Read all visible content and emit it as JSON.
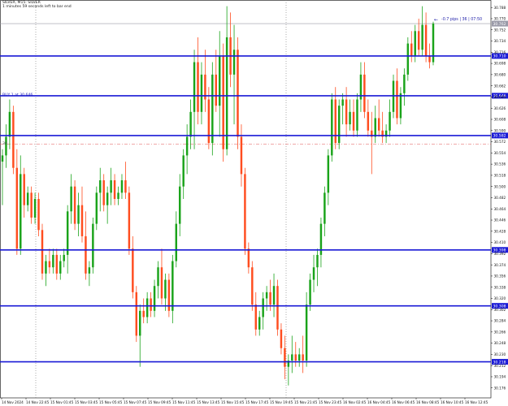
{
  "header": {
    "symbol_line": "SILVER, M15:  SILVER",
    "countdown": "1 minutes 59 seconds left to bar end"
  },
  "buy_label": "BUY 1 at 30.646",
  "side_number": "30.",
  "pip_info": "-0.7 pips | 36 | 07:50",
  "pip_arrow": "←",
  "colors": {
    "bull": "#1aa31a",
    "bear": "#ff4d1f",
    "hline": "#1a1ad6",
    "bid_line": "#e05050",
    "price_box": "#1a1ad6",
    "current_line": "#9a9aa8"
  },
  "chart_data": {
    "type": "candlestick",
    "timeframe": "M15",
    "ylim": [
      30.16,
      30.8
    ],
    "y_tick_labels": [
      "30.788",
      "30.770",
      "30.752",
      "30.734",
      "30.716",
      "30.698",
      "30.680",
      "30.662",
      "30.644",
      "30.626",
      "30.608",
      "30.590",
      "30.572",
      "30.554",
      "30.536",
      "30.518",
      "30.500",
      "30.482",
      "30.464",
      "30.446",
      "30.428",
      "30.410",
      "30.392",
      "30.374",
      "30.356",
      "30.338",
      "30.320",
      "30.302",
      "30.284",
      "30.266",
      "30.248",
      "30.230",
      "30.212",
      "30.194",
      "30.176"
    ],
    "x_tick_labels": [
      "14 Nov 2024",
      "14 Nov 22:45",
      "15 Nov 01:45",
      "15 Nov 03:45",
      "15 Nov 05:45",
      "15 Nov 07:45",
      "15 Nov 09:45",
      "15 Nov 11:45",
      "15 Nov 13:45",
      "15 Nov 15:45",
      "15 Nov 17:45",
      "15 Nov 19:45",
      "15 Nov 21:45",
      "15 Nov 23:45",
      "16 Nov 02:45",
      "16 Nov 04:45",
      "16 Nov 06:45",
      "16 Nov 08:45",
      "16 Nov 10:45",
      "16 Nov 12:45"
    ],
    "horizontal_levels": [
      {
        "price": 30.71,
        "label": "30.710"
      },
      {
        "price": 30.646,
        "label": "30.646"
      },
      {
        "price": 30.582,
        "label": "30.582"
      },
      {
        "price": 30.398,
        "label": "30.398"
      },
      {
        "price": 30.308,
        "label": "30.308"
      },
      {
        "price": 30.218,
        "label": "30.218"
      }
    ],
    "current_price": {
      "price": 30.762,
      "label": "30.762"
    },
    "bid_line": 30.568,
    "candles": [
      {
        "o": 30.54,
        "h": 30.56,
        "l": 30.47,
        "c": 30.55
      },
      {
        "o": 30.55,
        "h": 30.6,
        "l": 30.53,
        "c": 30.58
      },
      {
        "o": 30.58,
        "h": 30.64,
        "l": 30.56,
        "c": 30.62
      },
      {
        "o": 30.62,
        "h": 30.63,
        "l": 30.52,
        "c": 30.53
      },
      {
        "o": 30.53,
        "h": 30.56,
        "l": 30.39,
        "c": 30.4
      },
      {
        "o": 30.4,
        "h": 30.55,
        "l": 30.39,
        "c": 30.52
      },
      {
        "o": 30.52,
        "h": 30.53,
        "l": 30.45,
        "c": 30.47
      },
      {
        "o": 30.47,
        "h": 30.5,
        "l": 30.46,
        "c": 30.49
      },
      {
        "o": 30.49,
        "h": 30.5,
        "l": 30.44,
        "c": 30.45
      },
      {
        "o": 30.45,
        "h": 30.49,
        "l": 30.44,
        "c": 30.48
      },
      {
        "o": 30.48,
        "h": 30.49,
        "l": 30.42,
        "c": 30.43
      },
      {
        "o": 30.43,
        "h": 30.44,
        "l": 30.35,
        "c": 30.36
      },
      {
        "o": 30.36,
        "h": 30.39,
        "l": 30.34,
        "c": 30.38
      },
      {
        "o": 30.38,
        "h": 30.4,
        "l": 30.36,
        "c": 30.37
      },
      {
        "o": 30.37,
        "h": 30.4,
        "l": 30.36,
        "c": 30.39
      },
      {
        "o": 30.39,
        "h": 30.4,
        "l": 30.35,
        "c": 30.36
      },
      {
        "o": 30.36,
        "h": 30.39,
        "l": 30.35,
        "c": 30.38
      },
      {
        "o": 30.38,
        "h": 30.4,
        "l": 30.37,
        "c": 30.39
      },
      {
        "o": 30.39,
        "h": 30.47,
        "l": 30.36,
        "c": 30.46
      },
      {
        "o": 30.46,
        "h": 30.52,
        "l": 30.44,
        "c": 30.5
      },
      {
        "o": 30.5,
        "h": 30.51,
        "l": 30.43,
        "c": 30.44
      },
      {
        "o": 30.44,
        "h": 30.49,
        "l": 30.42,
        "c": 30.47
      },
      {
        "o": 30.47,
        "h": 30.5,
        "l": 30.41,
        "c": 30.42
      },
      {
        "o": 30.42,
        "h": 30.46,
        "l": 30.35,
        "c": 30.36
      },
      {
        "o": 30.36,
        "h": 30.38,
        "l": 30.34,
        "c": 30.37
      },
      {
        "o": 30.37,
        "h": 30.45,
        "l": 30.36,
        "c": 30.44
      },
      {
        "o": 30.44,
        "h": 30.5,
        "l": 30.43,
        "c": 30.49
      },
      {
        "o": 30.49,
        "h": 30.53,
        "l": 30.46,
        "c": 30.51
      },
      {
        "o": 30.51,
        "h": 30.52,
        "l": 30.46,
        "c": 30.47
      },
      {
        "o": 30.47,
        "h": 30.5,
        "l": 30.44,
        "c": 30.49
      },
      {
        "o": 30.49,
        "h": 30.53,
        "l": 30.47,
        "c": 30.51
      },
      {
        "o": 30.51,
        "h": 30.52,
        "l": 30.47,
        "c": 30.48
      },
      {
        "o": 30.48,
        "h": 30.5,
        "l": 30.47,
        "c": 30.49
      },
      {
        "o": 30.49,
        "h": 30.52,
        "l": 30.48,
        "c": 30.51
      },
      {
        "o": 30.51,
        "h": 30.54,
        "l": 30.48,
        "c": 30.49
      },
      {
        "o": 30.49,
        "h": 30.5,
        "l": 30.39,
        "c": 30.4
      },
      {
        "o": 30.4,
        "h": 30.42,
        "l": 30.32,
        "c": 30.33
      },
      {
        "o": 30.33,
        "h": 30.34,
        "l": 30.25,
        "c": 30.26
      },
      {
        "o": 30.26,
        "h": 30.31,
        "l": 30.21,
        "c": 30.3
      },
      {
        "o": 30.3,
        "h": 30.32,
        "l": 30.28,
        "c": 30.29
      },
      {
        "o": 30.29,
        "h": 30.33,
        "l": 30.28,
        "c": 30.32
      },
      {
        "o": 30.32,
        "h": 30.33,
        "l": 30.29,
        "c": 30.3
      },
      {
        "o": 30.3,
        "h": 30.35,
        "l": 30.29,
        "c": 30.34
      },
      {
        "o": 30.34,
        "h": 30.38,
        "l": 30.32,
        "c": 30.37
      },
      {
        "o": 30.37,
        "h": 30.4,
        "l": 30.31,
        "c": 30.32
      },
      {
        "o": 30.32,
        "h": 30.36,
        "l": 30.3,
        "c": 30.35
      },
      {
        "o": 30.35,
        "h": 30.36,
        "l": 30.29,
        "c": 30.3
      },
      {
        "o": 30.3,
        "h": 30.39,
        "l": 30.28,
        "c": 30.38
      },
      {
        "o": 30.38,
        "h": 30.46,
        "l": 30.37,
        "c": 30.44
      },
      {
        "o": 30.44,
        "h": 30.52,
        "l": 30.42,
        "c": 30.5
      },
      {
        "o": 30.5,
        "h": 30.56,
        "l": 30.48,
        "c": 30.55
      },
      {
        "o": 30.55,
        "h": 30.6,
        "l": 30.52,
        "c": 30.58
      },
      {
        "o": 30.58,
        "h": 30.64,
        "l": 30.56,
        "c": 30.62
      },
      {
        "o": 30.62,
        "h": 30.72,
        "l": 30.56,
        "c": 30.7
      },
      {
        "o": 30.7,
        "h": 30.74,
        "l": 30.6,
        "c": 30.62
      },
      {
        "o": 30.62,
        "h": 30.7,
        "l": 30.6,
        "c": 30.68
      },
      {
        "o": 30.68,
        "h": 30.72,
        "l": 30.62,
        "c": 30.64
      },
      {
        "o": 30.64,
        "h": 30.66,
        "l": 30.56,
        "c": 30.57
      },
      {
        "o": 30.57,
        "h": 30.7,
        "l": 30.55,
        "c": 30.68
      },
      {
        "o": 30.68,
        "h": 30.72,
        "l": 30.62,
        "c": 30.63
      },
      {
        "o": 30.63,
        "h": 30.75,
        "l": 30.58,
        "c": 30.71
      },
      {
        "o": 30.71,
        "h": 30.73,
        "l": 30.54,
        "c": 30.56
      },
      {
        "o": 30.56,
        "h": 30.79,
        "l": 30.55,
        "c": 30.74
      },
      {
        "o": 30.74,
        "h": 30.78,
        "l": 30.66,
        "c": 30.68
      },
      {
        "o": 30.68,
        "h": 30.76,
        "l": 30.6,
        "c": 30.72
      },
      {
        "o": 30.72,
        "h": 30.74,
        "l": 30.56,
        "c": 30.58
      },
      {
        "o": 30.58,
        "h": 30.6,
        "l": 30.5,
        "c": 30.52
      },
      {
        "o": 30.52,
        "h": 30.53,
        "l": 30.39,
        "c": 30.4
      },
      {
        "o": 30.4,
        "h": 30.41,
        "l": 30.36,
        "c": 30.37
      },
      {
        "o": 30.37,
        "h": 30.38,
        "l": 30.3,
        "c": 30.31
      },
      {
        "o": 30.31,
        "h": 30.33,
        "l": 30.26,
        "c": 30.27
      },
      {
        "o": 30.27,
        "h": 30.3,
        "l": 30.26,
        "c": 30.29
      },
      {
        "o": 30.29,
        "h": 30.33,
        "l": 30.27,
        "c": 30.32
      },
      {
        "o": 30.32,
        "h": 30.34,
        "l": 30.3,
        "c": 30.33
      },
      {
        "o": 30.33,
        "h": 30.35,
        "l": 30.3,
        "c": 30.31
      },
      {
        "o": 30.31,
        "h": 30.36,
        "l": 30.29,
        "c": 30.34
      },
      {
        "o": 30.34,
        "h": 30.35,
        "l": 30.26,
        "c": 30.27
      },
      {
        "o": 30.27,
        "h": 30.28,
        "l": 30.23,
        "c": 30.24
      },
      {
        "o": 30.24,
        "h": 30.26,
        "l": 30.19,
        "c": 30.21
      },
      {
        "o": 30.21,
        "h": 30.23,
        "l": 30.18,
        "c": 30.22
      },
      {
        "o": 30.22,
        "h": 30.26,
        "l": 30.2,
        "c": 30.23
      },
      {
        "o": 30.23,
        "h": 30.25,
        "l": 30.21,
        "c": 30.22
      },
      {
        "o": 30.22,
        "h": 30.24,
        "l": 30.21,
        "c": 30.23
      },
      {
        "o": 30.23,
        "h": 30.26,
        "l": 30.2,
        "c": 30.22
      },
      {
        "o": 30.22,
        "h": 30.33,
        "l": 30.21,
        "c": 30.31
      },
      {
        "o": 30.31,
        "h": 30.36,
        "l": 30.3,
        "c": 30.35
      },
      {
        "o": 30.35,
        "h": 30.39,
        "l": 30.33,
        "c": 30.37
      },
      {
        "o": 30.37,
        "h": 30.4,
        "l": 30.34,
        "c": 30.39
      },
      {
        "o": 30.39,
        "h": 30.45,
        "l": 30.37,
        "c": 30.44
      },
      {
        "o": 30.44,
        "h": 30.5,
        "l": 30.42,
        "c": 30.49
      },
      {
        "o": 30.49,
        "h": 30.56,
        "l": 30.47,
        "c": 30.55
      },
      {
        "o": 30.55,
        "h": 30.65,
        "l": 30.54,
        "c": 30.64
      },
      {
        "o": 30.64,
        "h": 30.66,
        "l": 30.56,
        "c": 30.57
      },
      {
        "o": 30.57,
        "h": 30.64,
        "l": 30.56,
        "c": 30.63
      },
      {
        "o": 30.63,
        "h": 30.65,
        "l": 30.6,
        "c": 30.64
      },
      {
        "o": 30.64,
        "h": 30.66,
        "l": 30.58,
        "c": 30.6
      },
      {
        "o": 30.6,
        "h": 30.64,
        "l": 30.59,
        "c": 30.62
      },
      {
        "o": 30.62,
        "h": 30.64,
        "l": 30.58,
        "c": 30.59
      },
      {
        "o": 30.59,
        "h": 30.65,
        "l": 30.58,
        "c": 30.64
      },
      {
        "o": 30.64,
        "h": 30.7,
        "l": 30.62,
        "c": 30.68
      },
      {
        "o": 30.68,
        "h": 30.7,
        "l": 30.61,
        "c": 30.62
      },
      {
        "o": 30.62,
        "h": 30.64,
        "l": 30.58,
        "c": 30.59
      },
      {
        "o": 30.59,
        "h": 30.62,
        "l": 30.52,
        "c": 30.58
      },
      {
        "o": 30.58,
        "h": 30.63,
        "l": 30.57,
        "c": 30.61
      },
      {
        "o": 30.61,
        "h": 30.64,
        "l": 30.58,
        "c": 30.59
      },
      {
        "o": 30.59,
        "h": 30.62,
        "l": 30.57,
        "c": 30.58
      },
      {
        "o": 30.58,
        "h": 30.6,
        "l": 30.57,
        "c": 30.59
      },
      {
        "o": 30.59,
        "h": 30.64,
        "l": 30.58,
        "c": 30.62
      },
      {
        "o": 30.62,
        "h": 30.68,
        "l": 30.61,
        "c": 30.67
      },
      {
        "o": 30.67,
        "h": 30.69,
        "l": 30.6,
        "c": 30.61
      },
      {
        "o": 30.61,
        "h": 30.66,
        "l": 30.6,
        "c": 30.65
      },
      {
        "o": 30.65,
        "h": 30.69,
        "l": 30.63,
        "c": 30.68
      },
      {
        "o": 30.68,
        "h": 30.74,
        "l": 30.67,
        "c": 30.73
      },
      {
        "o": 30.73,
        "h": 30.75,
        "l": 30.7,
        "c": 30.71
      },
      {
        "o": 30.71,
        "h": 30.76,
        "l": 30.7,
        "c": 30.75
      },
      {
        "o": 30.75,
        "h": 30.77,
        "l": 30.71,
        "c": 30.72
      },
      {
        "o": 30.72,
        "h": 30.79,
        "l": 30.71,
        "c": 30.76
      },
      {
        "o": 30.76,
        "h": 30.78,
        "l": 30.7,
        "c": 30.71
      },
      {
        "o": 30.71,
        "h": 30.73,
        "l": 30.69,
        "c": 30.7
      },
      {
        "o": 30.7,
        "h": 30.765,
        "l": 30.695,
        "c": 30.762
      }
    ]
  }
}
